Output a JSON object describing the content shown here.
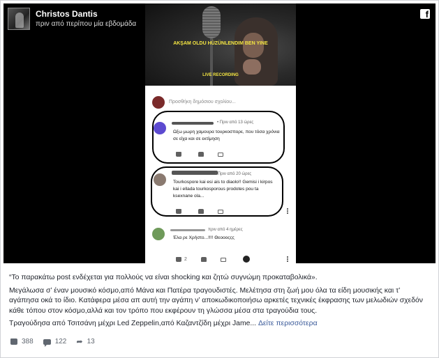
{
  "post": {
    "author_name": "Christos Dantis",
    "timestamp": "πριν από περίπου μία εβδομάδα",
    "brand_icon": "facebook-icon",
    "text_intro": "“Το παρακάτω post ενδέχεται για πολλούς να είναι shocking και ζητώ συγνώμη προκαταβολικά».",
    "text_body": "Μεγάλωσα σ’ έναν μουσικό κόσμο,από Μάνα και Πατέρα τραγουδιστές. Μελέτησα στη ζωή μου όλα τα είδη μουσικής και τ’ αγάπησα οκά το ίδιο. Κατάφερα μέσα απ αυτή την αγάπη ν’ αποκωδικοποιήσω αρκετές τεχνικές έκφρασης των μελωδιών σχεδόν κάθε τόπου στον κόσμο,αλλά και τον τρόπο που εκφέρουν τη γλώσσα μέσα στα τραγούδια τους.",
    "text_tail": "Τραγούδησα από Τσιτσάνη μέχρι Led Zeppelin,από Καζαντζίδη μέχρι Jame...",
    "see_more": "Δείτε περισσότερα",
    "stats": {
      "likes": "388",
      "comments": "122",
      "shares": "13"
    }
  },
  "screenshot": {
    "video_caption_top": "AKŞAM OLDU HÜZÜNLENDIM BEN YINE",
    "video_caption_bottom": "LIVE RECORDING",
    "comments_header": "Προσθήκη δημόσιου σχολίου...",
    "comments": [
      {
        "meta": "• Πριν από 13 ώρες",
        "text": "Ωξω μωρη χαμουρα τουρκοσπορε, που τόσα χρόνια σε είχα και σε εκτίμηση",
        "likes": "",
        "avatar_color": "#5c4ad0"
      },
      {
        "meta": "• Πριν από 20 ώρες",
        "text": "Tourkospore kai esi ais to diaolo!! Gemisi i kirpos kai i ellada tourkosporous prodotes pou ta ksexnane ola...",
        "likes": "",
        "avatar_color": "#8a7a70"
      },
      {
        "meta": "πριν από 4 ημέρες",
        "text": "Έλα ρε Χρήστο...!!!! Θεοοοςςς",
        "likes": "2",
        "avatar_color": "#6f9a5a"
      }
    ]
  },
  "colors": {
    "link": "#385898",
    "meta": "#606770",
    "highlight_ring": "#000000"
  }
}
